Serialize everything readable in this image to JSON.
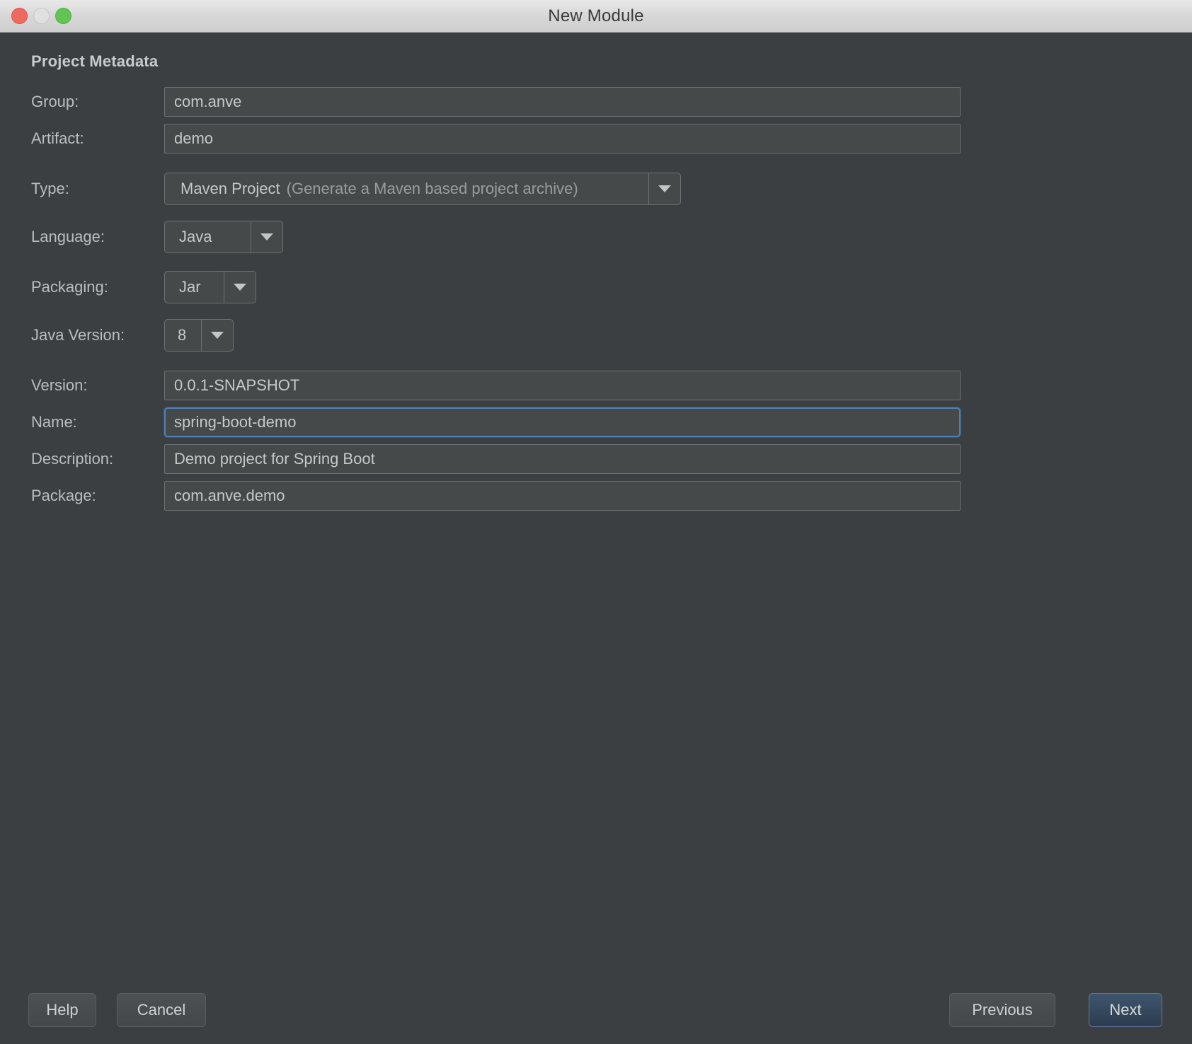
{
  "window": {
    "title": "New Module",
    "controls": {
      "close": "close-button",
      "minimize": "minimize-button",
      "maximize": "maximize-button"
    }
  },
  "section": {
    "title": "Project Metadata"
  },
  "fields": {
    "group": {
      "label": "Group:",
      "value": "com.anve"
    },
    "artifact": {
      "label": "Artifact:",
      "value": "demo"
    },
    "type": {
      "label": "Type:",
      "value": "Maven Project",
      "hint": "(Generate a Maven based project archive)"
    },
    "language": {
      "label": "Language:",
      "value": "Java"
    },
    "packaging": {
      "label": "Packaging:",
      "value": "Jar"
    },
    "java_version": {
      "label": "Java Version:",
      "value": "8"
    },
    "version": {
      "label": "Version:",
      "value": "0.0.1-SNAPSHOT"
    },
    "name": {
      "label": "Name:",
      "value": "spring-boot-demo",
      "focused": true
    },
    "description": {
      "label": "Description:",
      "value": "Demo project for Spring Boot"
    },
    "package": {
      "label": "Package:",
      "value": "com.anve.demo"
    }
  },
  "footer": {
    "help": "Help",
    "cancel": "Cancel",
    "previous": "Previous",
    "next": "Next"
  },
  "colors": {
    "window_bg": "#3c3f41",
    "input_bg": "#45494a",
    "input_border": "#6d7173",
    "text": "#c6c8c9",
    "label": "#bbbdbe",
    "focus_blue": "#4d7fb5",
    "next_blue": "#3e556f",
    "titlebar": "#d6d6d6",
    "tl_close": "#ec6a5f",
    "tl_min": "#e0e0e0",
    "tl_max": "#61c454"
  }
}
